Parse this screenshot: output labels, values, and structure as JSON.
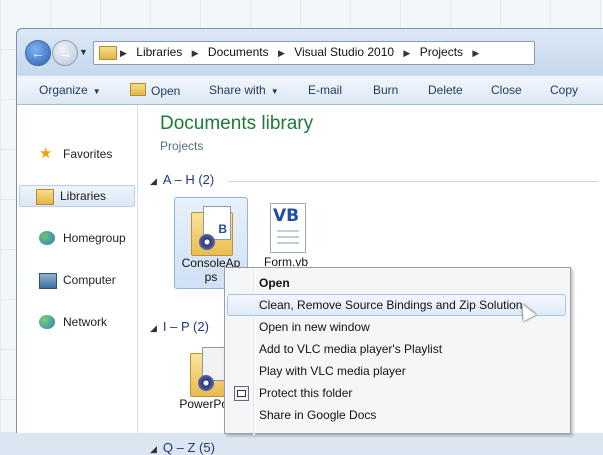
{
  "breadcrumb": [
    "Libraries",
    "Documents",
    "Visual Studio 2010",
    "Projects"
  ],
  "toolbar": {
    "organize": "Organize",
    "open": "Open",
    "share_with": "Share with",
    "email": "E-mail",
    "burn": "Burn",
    "delete": "Delete",
    "close": "Close",
    "copy": "Copy"
  },
  "sidebar": {
    "items": [
      {
        "label": "Favorites",
        "icon": "star-icon"
      },
      {
        "label": "Libraries",
        "icon": "libraries-icon"
      },
      {
        "label": "Homegroup",
        "icon": "homegroup-icon"
      },
      {
        "label": "Computer",
        "icon": "computer-icon"
      },
      {
        "label": "Network",
        "icon": "network-icon"
      }
    ]
  },
  "content": {
    "title": "Documents library",
    "subtitle": "Projects",
    "groups": [
      {
        "label": "A – H (2)"
      },
      {
        "label": "I – P (2)"
      },
      {
        "label": "Q – Z (5)"
      }
    ],
    "files": [
      {
        "name": "ConsoleAp\nps",
        "line1": "ConsoleAp",
        "line2": "ps",
        "icon": "folder-icon"
      },
      {
        "name": "Form.vb",
        "icon": "vb-file-icon"
      },
      {
        "name": "PowerPoint",
        "icon": "folder-icon"
      }
    ]
  },
  "context_menu": {
    "items": [
      {
        "label": "Open",
        "bold": true
      },
      {
        "label": "Clean, Remove Source Bindings and Zip Solution",
        "highlighted": true
      },
      {
        "label": "Open in new window"
      },
      {
        "label": "Add to VLC media player's Playlist"
      },
      {
        "label": "Play with VLC media player"
      },
      {
        "label": "Protect this folder",
        "icon": "protect-icon"
      },
      {
        "label": "Share in Google Docs"
      }
    ]
  }
}
